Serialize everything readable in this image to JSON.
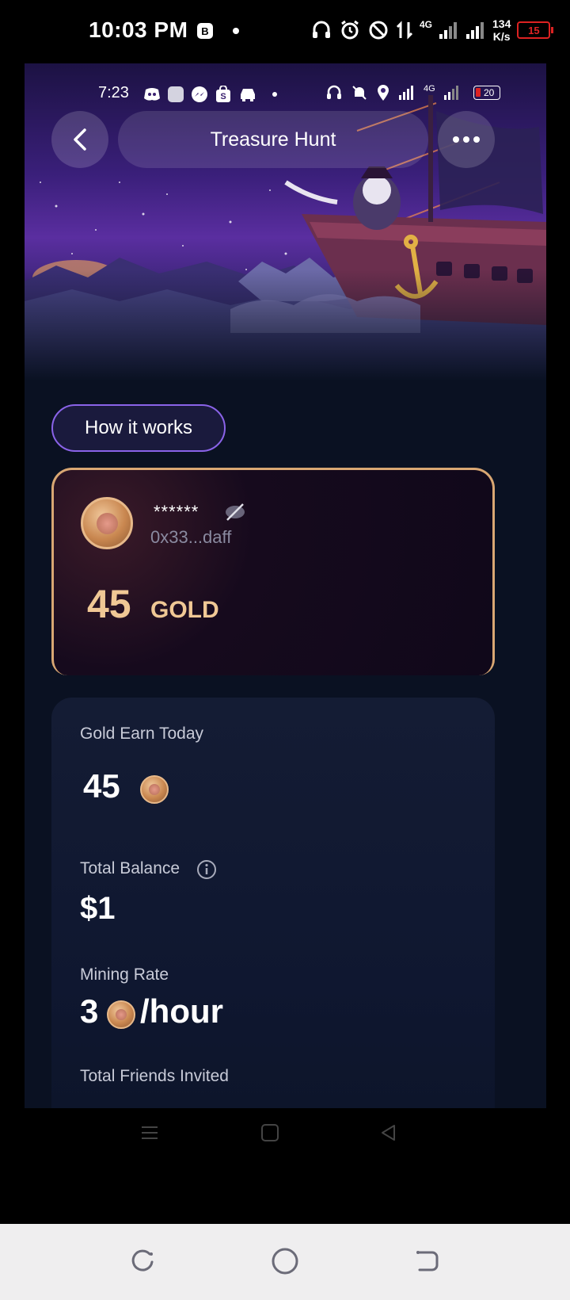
{
  "outer_status": {
    "time": "10:03 PM",
    "net_speed_value": "134",
    "net_speed_unit": "K/s",
    "battery": "15",
    "network_type": "4G"
  },
  "inner_status": {
    "time": "7:23",
    "battery": "20",
    "network_type": "4G"
  },
  "header": {
    "title": "Treasure Hunt"
  },
  "how_it_works": {
    "label": "How it works"
  },
  "account_card": {
    "name": "******",
    "address": "0x33...daff",
    "balance_amount": "45",
    "balance_unit": "GOLD"
  },
  "stats": {
    "gold_earn_today_label": "Gold Earn Today",
    "gold_earn_today_value": "45",
    "total_balance_label": "Total Balance",
    "total_balance_value": "$1",
    "mining_rate_label": "Mining Rate",
    "mining_rate_value": "3",
    "mining_rate_unit": "/hour",
    "total_friends_label": "Total Friends Invited"
  },
  "colors": {
    "accent_purple": "#8a63e8",
    "gold": "#f0c895",
    "card_border": "#d9a773",
    "background": "#0a1122"
  }
}
